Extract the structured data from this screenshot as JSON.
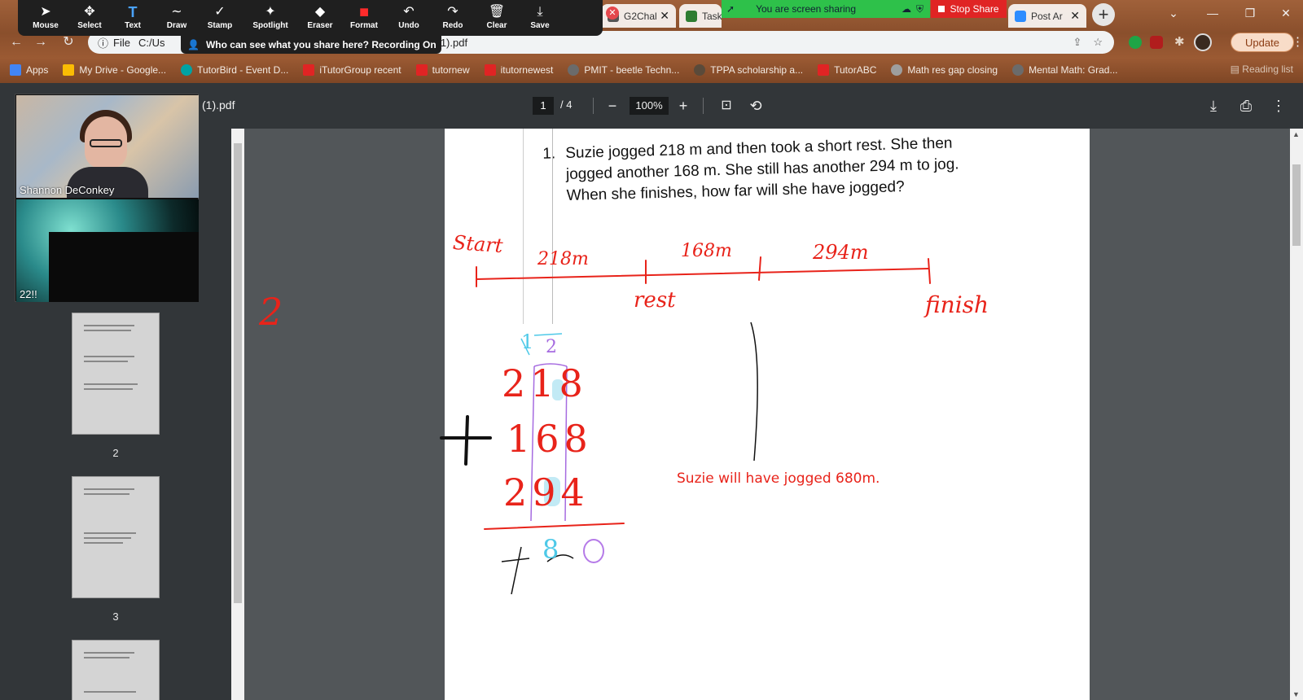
{
  "tabs": [
    {
      "label": "G2Chal",
      "icon_color": "#555555"
    },
    {
      "label": "Task",
      "icon_color": "#2e7d32"
    },
    {
      "label": "Post Ar",
      "icon_color": "#2d8cff"
    }
  ],
  "address": {
    "info": "File",
    "url_left": "C:/Us",
    "url_right": "%20(1).pdf"
  },
  "update_label": "Update",
  "bookmarks": [
    {
      "label": "Apps",
      "color": "#4285f4"
    },
    {
      "label": "My Drive - Google...",
      "color": "#fbbc04"
    },
    {
      "label": "TutorBird - Event D...",
      "color": "#00a3a3"
    },
    {
      "label": "iTutorGroup recent",
      "color": "#e02424"
    },
    {
      "label": "tutornew",
      "color": "#e02424"
    },
    {
      "label": "itutornewest",
      "color": "#e02424"
    },
    {
      "label": "PMIT - beetle Techn...",
      "color": "#6b6b6b"
    },
    {
      "label": "TPPA scholarship a...",
      "color": "#5a4a3a"
    },
    {
      "label": "TutorABC",
      "color": "#e02424"
    },
    {
      "label": "Math res gap closing",
      "color": "#9e9e9e"
    },
    {
      "label": "Mental Math: Grad...",
      "color": "#6b6b6b"
    }
  ],
  "reading_list": "Reading list",
  "zoom_toolbar": [
    {
      "label": "Mouse",
      "icon": "➤"
    },
    {
      "label": "Select",
      "icon": "✥"
    },
    {
      "label": "Text",
      "icon": "T"
    },
    {
      "label": "Draw",
      "icon": "∼"
    },
    {
      "label": "Stamp",
      "icon": "✓"
    },
    {
      "label": "Spotlight",
      "icon": "✦"
    },
    {
      "label": "Eraser",
      "icon": "◆"
    },
    {
      "label": "Format",
      "icon": "■"
    },
    {
      "label": "Undo",
      "icon": "↶"
    },
    {
      "label": "Redo",
      "icon": "↷"
    },
    {
      "label": "Clear",
      "icon": "🗑"
    },
    {
      "label": "Save",
      "icon": "⤓"
    }
  ],
  "sharing_banner": "You are screen sharing",
  "stop_share": "Stop Share",
  "who_can_see": "Who can see what you share here? Recording On",
  "pdf": {
    "title": "(1).pdf",
    "page_current": "1",
    "page_total": "/ 4",
    "zoom": "100%",
    "thumb_numbers": [
      "2",
      "3"
    ]
  },
  "video": {
    "participant1": "Shannon DeConkey",
    "participant2": "22!!"
  },
  "question": {
    "number": "1.",
    "text": "Suzie jogged 218 m and then took a short rest. She then jogged another 168 m. She still has another 294 m to jog. When she finishes, how far will she have jogged?"
  },
  "answer_text": "Suzie will have jogged 680m.",
  "annotations": {
    "start": "Start",
    "seg1": "218m",
    "seg2": "168m",
    "seg3": "294m",
    "rest": "rest",
    "finish": "finish",
    "side_digit": "2",
    "carry1": "1",
    "carry2": "2",
    "row1": "218",
    "row2": "168",
    "row3": "294",
    "plus": "+",
    "sum_digits": [
      "8",
      "0"
    ]
  },
  "colors": {
    "ink_red": "#e8231a",
    "ink_purple": "#a66be0",
    "ink_cyan": "#4ec9e8",
    "share_green": "#2ec14a",
    "stop_red": "#e02424"
  }
}
